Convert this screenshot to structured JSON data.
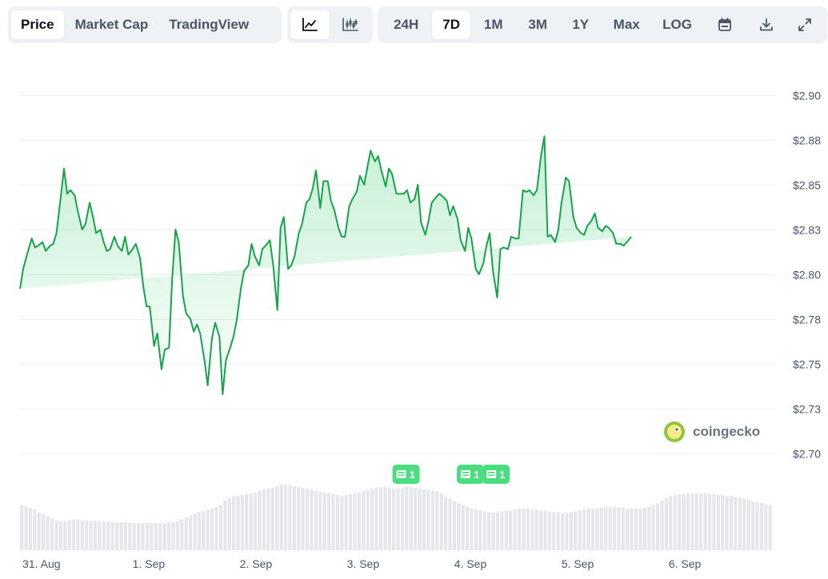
{
  "toolbar": {
    "view_tabs": [
      {
        "label": "Price",
        "active": true
      },
      {
        "label": "Market Cap",
        "active": false
      },
      {
        "label": "TradingView",
        "active": false
      }
    ],
    "chart_types": [
      {
        "icon": "line-chart-icon",
        "active": true
      },
      {
        "icon": "candlestick-icon",
        "active": false
      }
    ],
    "ranges": [
      {
        "label": "24H",
        "active": false
      },
      {
        "label": "7D",
        "active": true
      },
      {
        "label": "1M",
        "active": false
      },
      {
        "label": "3M",
        "active": false
      },
      {
        "label": "1Y",
        "active": false
      },
      {
        "label": "Max",
        "active": false
      },
      {
        "label": "LOG",
        "active": false
      }
    ],
    "tools": [
      {
        "icon": "calendar-icon"
      },
      {
        "icon": "download-icon"
      },
      {
        "icon": "expand-icon"
      }
    ]
  },
  "watermark": "coingecko",
  "news_markers": [
    {
      "x": 3.4,
      "count": "1"
    },
    {
      "x": 4.0,
      "count": "1"
    },
    {
      "x": 4.24,
      "count": "1"
    }
  ],
  "colors": {
    "line": "#16a34a",
    "fill": "#22c55e",
    "volume": "#e5e7eb",
    "news": "#4ade80",
    "grid": "#eef0f3"
  },
  "chart_data": {
    "type": "area",
    "ylim": [
      2.7,
      2.9
    ],
    "yticks": [
      2.7,
      2.725,
      2.75,
      2.775,
      2.8,
      2.825,
      2.85,
      2.875,
      2.9
    ],
    "ytick_labels": [
      "$2.70",
      "$2.73",
      "$2.75",
      "$2.78",
      "$2.80",
      "$2.83",
      "$2.85",
      "$2.88",
      "$2.90"
    ],
    "xlim": [
      -0.2,
      6.82
    ],
    "xticks": [
      0,
      1,
      2,
      3,
      4,
      5,
      6
    ],
    "xtick_labels": [
      "31. Aug",
      "1. Sep",
      "2. Sep",
      "3. Sep",
      "4. Sep",
      "5. Sep",
      "6. Sep"
    ],
    "x": [
      -0.2,
      -0.17,
      -0.13,
      -0.09,
      -0.06,
      -0.03,
      0.01,
      0.04,
      0.08,
      0.11,
      0.14,
      0.18,
      0.21,
      0.24,
      0.27,
      0.31,
      0.34,
      0.38,
      0.41,
      0.45,
      0.48,
      0.51,
      0.55,
      0.58,
      0.61,
      0.64,
      0.68,
      0.71,
      0.75,
      0.78,
      0.81,
      0.85,
      0.88,
      0.92,
      0.95,
      0.98,
      1.01,
      1.05,
      1.08,
      1.12,
      1.15,
      1.19,
      1.22,
      1.25,
      1.28,
      1.32,
      1.35,
      1.39,
      1.42,
      1.45,
      1.48,
      1.52,
      1.55,
      1.59,
      1.62,
      1.66,
      1.69,
      1.72,
      1.76,
      1.79,
      1.82,
      1.86,
      1.89,
      1.93,
      1.96,
      1.99,
      2.03,
      2.06,
      2.09,
      2.13,
      2.16,
      2.2,
      2.23,
      2.26,
      2.3,
      2.33,
      2.36,
      2.4,
      2.43,
      2.47,
      2.5,
      2.53,
      2.56,
      2.6,
      2.63,
      2.67,
      2.7,
      2.73,
      2.77,
      2.8,
      2.83,
      2.87,
      2.9,
      2.94,
      2.97,
      3.01,
      3.04,
      3.07,
      3.11,
      3.14,
      3.17,
      3.21,
      3.24,
      3.27,
      3.31,
      3.34,
      3.38,
      3.41,
      3.44,
      3.48,
      3.51,
      3.54,
      3.58,
      3.61,
      3.64,
      3.68,
      3.71,
      3.75,
      3.78,
      3.81,
      3.84,
      3.88,
      3.91,
      3.95,
      3.98,
      4.01,
      4.05,
      4.08,
      4.12,
      4.15,
      4.18,
      4.21,
      4.25,
      4.28,
      4.31,
      4.35,
      4.38,
      4.42,
      4.45,
      4.49,
      4.52,
      4.55,
      4.59,
      4.62,
      4.66,
      4.69,
      4.72,
      4.75,
      4.79,
      4.82,
      4.85,
      4.89,
      4.92,
      4.96,
      4.99,
      5.03,
      5.06,
      5.09,
      5.13,
      5.16,
      5.19,
      5.23,
      5.26,
      5.29,
      5.33,
      5.36,
      5.4,
      5.43,
      5.46,
      5.5,
      5.53,
      5.57,
      5.6,
      5.63,
      5.66,
      5.7,
      5.73,
      5.77,
      5.8,
      5.83,
      5.87,
      5.9,
      5.93,
      5.97,
      6.0,
      6.04,
      6.07,
      6.1,
      6.14,
      6.17,
      6.2,
      6.23,
      6.27,
      6.3,
      6.34,
      6.37,
      6.41,
      6.44,
      6.47,
      6.5,
      6.54,
      6.57,
      6.61,
      6.64,
      6.67,
      6.71,
      6.74,
      6.77,
      6.81
    ],
    "series": [
      {
        "values": [
          2.792,
          2.803,
          2.812,
          2.82,
          2.815,
          2.816,
          2.818,
          2.813,
          2.816,
          2.817,
          2.823,
          2.843,
          2.859,
          2.845,
          2.847,
          2.844,
          2.835,
          2.825,
          2.828,
          2.84,
          2.832,
          2.823,
          2.825,
          2.818,
          2.813,
          2.814,
          2.821,
          2.816,
          2.813,
          2.821,
          2.811,
          2.814,
          2.817,
          2.809,
          2.793,
          2.782,
          2.782,
          2.76,
          2.767,
          2.747,
          2.758,
          2.759,
          2.798,
          2.825,
          2.818,
          2.788,
          2.778,
          2.775,
          2.768,
          2.772,
          2.767,
          2.752,
          2.738,
          2.764,
          2.773,
          2.765,
          2.733,
          2.752,
          2.759,
          2.765,
          2.774,
          2.792,
          2.802,
          2.805,
          2.817,
          2.81,
          2.805,
          2.814,
          2.816,
          2.819,
          2.806,
          2.78,
          2.826,
          2.832,
          2.803,
          2.805,
          2.81,
          2.823,
          2.828,
          2.84,
          2.842,
          2.848,
          2.858,
          2.837,
          2.852,
          2.852,
          2.841,
          2.836,
          2.826,
          2.821,
          2.821,
          2.838,
          2.842,
          2.846,
          2.855,
          2.85,
          2.86,
          2.869,
          2.863,
          2.866,
          2.858,
          2.849,
          2.859,
          2.856,
          2.845,
          2.845,
          2.845,
          2.847,
          2.84,
          2.842,
          2.85,
          2.829,
          2.822,
          2.83,
          2.84,
          2.843,
          2.845,
          2.843,
          2.841,
          2.833,
          2.838,
          2.831,
          2.819,
          2.813,
          2.826,
          2.82,
          2.803,
          2.8,
          2.806,
          2.816,
          2.823,
          2.802,
          2.787,
          2.814,
          2.815,
          2.814,
          2.821,
          2.82,
          2.82,
          2.847,
          2.846,
          2.847,
          2.844,
          2.847,
          2.867,
          2.877,
          2.821,
          2.822,
          2.818,
          2.825,
          2.84,
          2.854,
          2.852,
          2.832,
          2.826,
          2.823,
          2.822,
          2.827,
          2.83,
          2.834,
          2.826,
          2.824,
          2.827,
          2.826,
          2.823,
          2.817,
          2.817,
          2.816,
          2.818,
          2.821
        ]
      }
    ],
    "volume": [
      0.5,
      0.48,
      0.47,
      0.45,
      0.42,
      0.4,
      0.38,
      0.35,
      0.33,
      0.32,
      0.32,
      0.33,
      0.34,
      0.34,
      0.33,
      0.33,
      0.32,
      0.32,
      0.32,
      0.32,
      0.31,
      0.31,
      0.31,
      0.31,
      0.31,
      0.3,
      0.3,
      0.3,
      0.3,
      0.3,
      0.3,
      0.3,
      0.3,
      0.3,
      0.31,
      0.31,
      0.32,
      0.34,
      0.36,
      0.38,
      0.4,
      0.42,
      0.43,
      0.45,
      0.46,
      0.48,
      0.5,
      0.55,
      0.58,
      0.6,
      0.6,
      0.61,
      0.62,
      0.63,
      0.64,
      0.66,
      0.67,
      0.68,
      0.69,
      0.71,
      0.73,
      0.73,
      0.72,
      0.71,
      0.7,
      0.69,
      0.68,
      0.67,
      0.66,
      0.65,
      0.64,
      0.63,
      0.62,
      0.61,
      0.6,
      0.61,
      0.62,
      0.63,
      0.64,
      0.66,
      0.67,
      0.68,
      0.69,
      0.7,
      0.7,
      0.69,
      0.68,
      0.68,
      0.69,
      0.7,
      0.7,
      0.69,
      0.68,
      0.68,
      0.67,
      0.66,
      0.65,
      0.63,
      0.6,
      0.57,
      0.54,
      0.52,
      0.5,
      0.48,
      0.46,
      0.45,
      0.44,
      0.43,
      0.42,
      0.42,
      0.42,
      0.43,
      0.44,
      0.44,
      0.45,
      0.46,
      0.46,
      0.46,
      0.45,
      0.45,
      0.44,
      0.44,
      0.43,
      0.42,
      0.42,
      0.41,
      0.41,
      0.42,
      0.43,
      0.44,
      0.45,
      0.46,
      0.46,
      0.47,
      0.47,
      0.48,
      0.48,
      0.48,
      0.47,
      0.47,
      0.46,
      0.46,
      0.46,
      0.46,
      0.47,
      0.48,
      0.5,
      0.52,
      0.55,
      0.58,
      0.6,
      0.61,
      0.62,
      0.62,
      0.63,
      0.63,
      0.63,
      0.63,
      0.63,
      0.62,
      0.62,
      0.61,
      0.61,
      0.6,
      0.6,
      0.59,
      0.58,
      0.57,
      0.56,
      0.54,
      0.53,
      0.52,
      0.51,
      0.5
    ]
  }
}
